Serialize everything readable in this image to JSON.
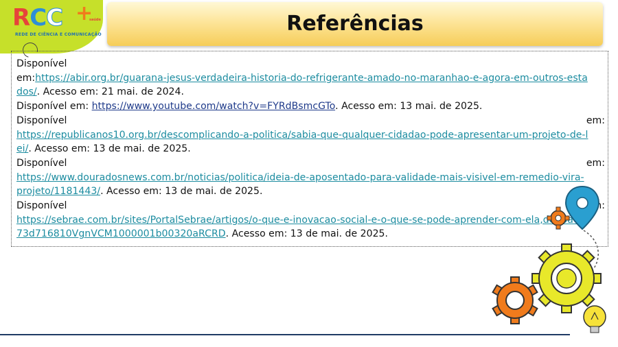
{
  "logo": {
    "letters": [
      "R",
      "C",
      "C"
    ],
    "plus": "+",
    "tagline": "REDE DE CIÊNCIA E COMUNICAÇÃO",
    "small": "saúde"
  },
  "header": {
    "title": "Referências"
  },
  "references": [
    {
      "label": "Disponível",
      "prefix": "em:",
      "url_part1": "https://abir.org.br/guarana-jesus-verdadeira-historia-do-refrigerante-amado-no-maranhao-e-agora-em-outros-esta",
      "url_part2": "dos/",
      "accessed": ".  Acesso em: 21 mai. de 2024."
    },
    {
      "prefix": "Disponível em: ",
      "url": "https://www.youtube.com/watch?v=FYRdBsmcGTo",
      "accessed": ". Acesso em: 13 mai. de 2025."
    },
    {
      "label": "Disponível",
      "label_end": "em:",
      "url_part1": "https://republicanos10.org.br/descomplicando-a-politica/sabia-que-qualquer-cidadao-pode-apresentar-um-projeto-de-l",
      "url_part2": "ei/",
      "accessed": ". Acesso em: 13 de mai. de 2025."
    },
    {
      "label": "Disponível",
      "label_end": "em:",
      "url_part1": "https://www.douradosnews.com.br/noticias/politica/ideia-de-aposentado-para-validade-mais-visivel-em-remedio-vira-",
      "url_part2": "projeto/1181443/",
      "accessed": ". Acesso em: 13 de mai. de 2025."
    },
    {
      "label": "Disponível",
      "label_end": "em:",
      "url_part1": "https://sebrae.com.br/sites/PortalSebrae/artigos/o-que-e-inovacao-social-e-o-que-se-pode-aprender-com-ela,deb6a62",
      "url_part2": "73d716810VgnVCM1000001b00320aRCRD",
      "accessed": ". Acesso em: 13 de mai. de 2025."
    }
  ],
  "colors": {
    "link": "#1c8ca0",
    "link_visited": "#1e3a8a",
    "banner_gold": "#f6cd58",
    "logo_green": "#c6e02a",
    "gear_yellow": "#e8e82a",
    "gear_orange": "#f07b1c"
  }
}
